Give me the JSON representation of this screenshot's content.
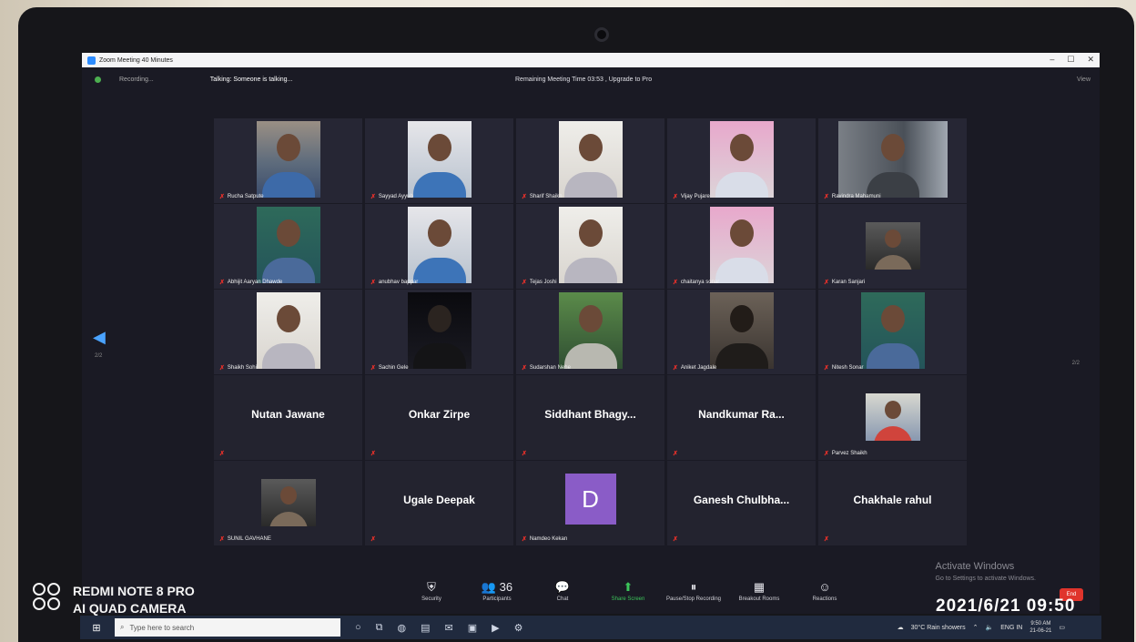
{
  "window": {
    "title": "Zoom Meeting 40 Minutes"
  },
  "status": {
    "recording": "Recording...",
    "talking": "Talking: Someone is talking...",
    "remaining": "Remaining Meeting Time 03:53 , Upgrade to Pro",
    "view": "View"
  },
  "grid": {
    "rows": [
      [
        {
          "name": "Rucha Satpute",
          "style": "v1"
        },
        {
          "name": "Sayyad Ayyub",
          "style": "v2"
        },
        {
          "name": "Sharif Shaikh",
          "style": "v3"
        },
        {
          "name": "Vijay Pujare",
          "style": "v4"
        },
        {
          "name": "Ravindra Mahamuni",
          "style": "v5"
        }
      ],
      [
        {
          "name": "Abhijit Aaryan Dhawde",
          "style": "v6"
        },
        {
          "name": "anubhav bappar",
          "style": "v2"
        },
        {
          "name": "Tejas Joshi",
          "style": "v3"
        },
        {
          "name": "chaitanya sonar",
          "style": "v4"
        },
        {
          "name": "Karan Sanjari",
          "style": "v11",
          "small": true
        }
      ],
      [
        {
          "name": "Shaikh Sohil",
          "style": "v3"
        },
        {
          "name": "Sachin Gele",
          "style": "v7"
        },
        {
          "name": "Sudarshan Nehe",
          "style": "v8"
        },
        {
          "name": "Aniket Jagdale",
          "style": "v9"
        },
        {
          "name": "Nitesh Sonar",
          "style": "v6"
        }
      ]
    ],
    "name_tiles_row4": [
      "Nutan Jawane",
      "Onkar Zirpe",
      "Siddhant  Bhagy...",
      "Nandkumar  Ra..."
    ],
    "row4_video": "Parvez Shaikh",
    "row5": {
      "video_name": "SUNIL GAVHANE",
      "ugale": "Ugale Deepak",
      "avatar_letter": "D",
      "avatar_name": "Namdeo Kekan",
      "ganesh": "Ganesh  Chulbha...",
      "chakhale": "Chakhale rahul"
    }
  },
  "nav": {
    "page_left": "2/2",
    "page_right": "2/2"
  },
  "toolbar": [
    {
      "label": "Security",
      "icon": "shield-icon",
      "glyph": "⛨"
    },
    {
      "label": "Participants",
      "icon": "participants-icon",
      "glyph": "👥 36"
    },
    {
      "label": "Chat",
      "icon": "chat-icon",
      "glyph": "💬"
    },
    {
      "label": "Share Screen",
      "icon": "share-screen-icon",
      "glyph": "⬆",
      "green": true
    },
    {
      "label": "Pause/Stop Recording",
      "icon": "recording-icon",
      "glyph": "⏸"
    },
    {
      "label": "Breakout Rooms",
      "icon": "breakout-rooms-icon",
      "glyph": "▦"
    },
    {
      "label": "Reactions",
      "icon": "reactions-icon",
      "glyph": "☺"
    }
  ],
  "end_label": "End",
  "activate": {
    "title": "Activate Windows",
    "sub": "Go to Settings to activate Windows."
  },
  "taskbar": {
    "search_placeholder": "Type here to search",
    "weather": "30°C  Rain showers",
    "lang": "ENG IN",
    "time": "9:50 AM",
    "date": "21-06-21"
  },
  "photo": {
    "device_line1": "REDMI NOTE 8 PRO",
    "device_line2": "AI QUAD CAMERA",
    "timestamp": "2021/6/21 09:50"
  }
}
